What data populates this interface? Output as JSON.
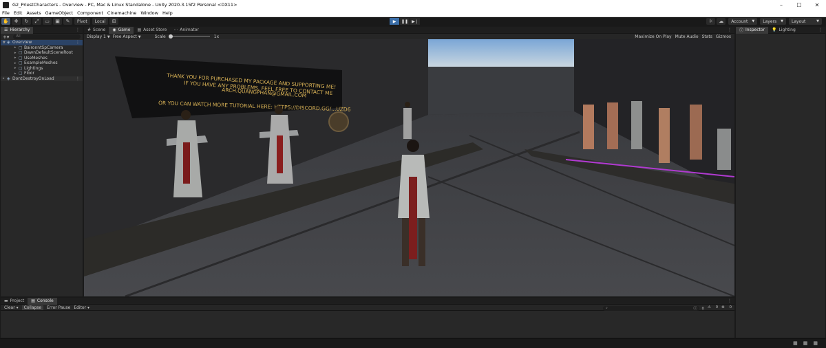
{
  "window": {
    "title": "G2_PriestCharacters - Overview - PC, Mac & Linux Standalone - Unity 2020.3.15f2 Personal <DX11>",
    "minimize": "–",
    "maximize": "☐",
    "close": "✕"
  },
  "menu": [
    "File",
    "Edit",
    "Assets",
    "GameObject",
    "Component",
    "Cinemachine",
    "Window",
    "Help"
  ],
  "toolbar": {
    "pivot": "Pivot",
    "local": "Local",
    "account": "Account",
    "layers": "Layers",
    "layout": "Layout"
  },
  "hierarchy": {
    "tab": "Hierarchy",
    "search_placeholder": "All",
    "scene1": "Overview",
    "items": [
      "BaironntSpCamera",
      "DawnDefaultSceneRoot",
      "UseMeshes",
      "ExampleMeshes",
      "Lightings",
      "Floor"
    ],
    "scene2": "DontDestroyOnLoad"
  },
  "center_tabs": {
    "scene": "Scene",
    "game": "Game",
    "asset_store": "Asset Store",
    "animator": "Animator"
  },
  "gamebar": {
    "display": "Display 1",
    "aspect": "Free Aspect",
    "scale_label": "Scale",
    "scale_value": "1x",
    "maximize": "Maximize On Play",
    "mute": "Mute Audio",
    "stats": "Stats",
    "gizmos": "Gizmos"
  },
  "viewport_text": {
    "line1": "THANK YOU FOR PURCHASED MY PACKAGE AND SUPPORTING ME!",
    "line2": "IF YOU HAVE ANY PROBLEMS, FEEL FREE TO CONTACT ME",
    "line3": "ARCH.QUANGPHAN@GMAIL.COM",
    "line4": "OR YOU CAN WATCH MORE TUTORIAL HERE: HTTPS://DISCORD.GG/...UZD6"
  },
  "inspector": {
    "tab1": "Inspector",
    "tab2": "Lighting"
  },
  "bottom": {
    "tab_project": "Project",
    "tab_console": "Console",
    "clear": "Clear",
    "collapse": "Collapse",
    "error_pause": "Error Pause",
    "editor": "Editor",
    "count_log": "0",
    "count_warn": "0",
    "count_err": "0"
  },
  "colors": {
    "accent": "#3b6ea8",
    "selected_row": "#2b4366",
    "panel": "#282828"
  }
}
